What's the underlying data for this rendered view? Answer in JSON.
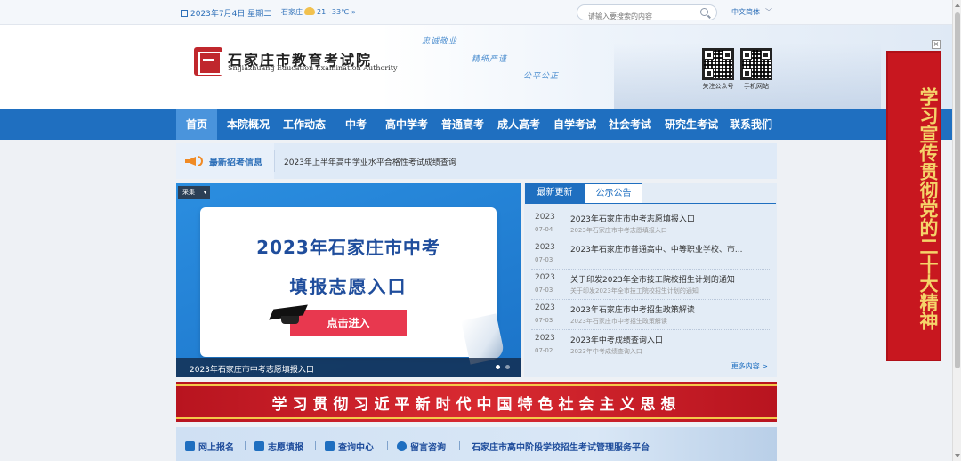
{
  "topbar": {
    "date": "2023年7月4日 星期二",
    "weather_city": "石家庄",
    "weather_temp": "21~33℃",
    "weather_more": "»",
    "search_placeholder": "请输入要搜索的内容",
    "language": "中文简体",
    "language_chevron": "﹀"
  },
  "header": {
    "title": "石家庄市教育考试院",
    "subtitle": "Shijiazhuang Education Examination Authority",
    "slogans": [
      "忠诚敬业",
      "精细严谨",
      "公平公正"
    ],
    "qr_labels": [
      "关注公众号",
      "手机网站"
    ]
  },
  "nav": {
    "items": [
      "首页",
      "本院概况",
      "工作动态",
      "中考",
      "高中学考",
      "普通高考",
      "成人高考",
      "自学考试",
      "社会考试",
      "研究生考试",
      "联系我们"
    ]
  },
  "notice": {
    "label": "最新招考信息",
    "text": "2023年上半年高中学业水平合格性考试成绩查询"
  },
  "banner": {
    "control": "采集",
    "control_caret": "▾",
    "line1": "2023年石家庄市中考",
    "line2": "填报志愿入口",
    "button": "点击进入",
    "caption": "2023年石家庄市中考志愿填报入口"
  },
  "news": {
    "tabs": [
      "最新更新",
      "公示公告"
    ],
    "items": [
      {
        "year": "2023",
        "md": "07-04",
        "title": "2023年石家庄市中考志愿填报入口",
        "sub": "2023年石家庄市中考志愿填报入口"
      },
      {
        "year": "2023",
        "md": "07-03",
        "title": "2023年石家庄市普通高中、中等职业学校、市...",
        "sub": ""
      },
      {
        "year": "2023",
        "md": "07-03",
        "title": "关于印发2023年全市技工院校招生计划的通知",
        "sub": "关于印发2023年全市技工院校招生计划的通知"
      },
      {
        "year": "2023",
        "md": "07-03",
        "title": "2023年石家庄市中考招生政策解读",
        "sub": "2023年石家庄市中考招生政策解读"
      },
      {
        "year": "2023",
        "md": "07-02",
        "title": "2023年中考成绩查询入口",
        "sub": "2023年中考成绩查询入口"
      }
    ],
    "more": "更多内容 >"
  },
  "red_banner": {
    "text": "学习贯彻习近平新时代中国特色社会主义思想"
  },
  "quick_links": [
    "网上报名",
    "志愿填报",
    "查询中心",
    "留言咨询",
    "石家庄市高中阶段学校招生考试管理服务平台"
  ],
  "side_banner": {
    "text": "学习宣传贯彻党的二十大精神",
    "close": "×"
  },
  "colors": {
    "nav_blue": "#1f6fc0",
    "nav_active": "#4a94dc",
    "red": "#c8171f",
    "gold": "#f5d46a"
  }
}
